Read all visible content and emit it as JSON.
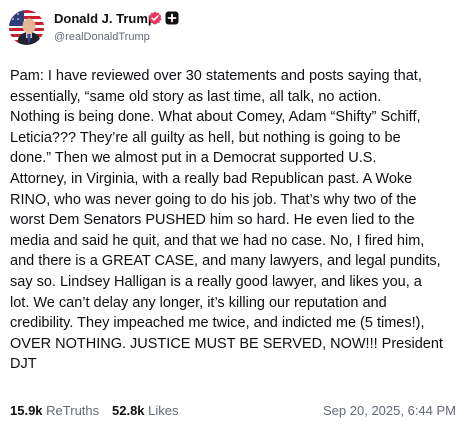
{
  "author": {
    "display_name": "Donald J. Trump",
    "handle": "@realDonaldTrump",
    "verified_icon": "verified-badge-icon",
    "extra_badge_icon": "plus-badge-icon",
    "verified_color": "#e8385d",
    "avatar_icon": "avatar-flag-portrait"
  },
  "post": {
    "lines": [
      "Pam: I have reviewed over 30 statements and posts saying that,",
      "essentially, “same old story as last time, all talk, no action.",
      "Nothing is being done. What about Comey, Adam “Shifty” Schiff,",
      "Leticia??? They’re all guilty as hell, but nothing is going to be",
      "done.” Then we almost put in a Democrat supported U.S.",
      "Attorney, in Virginia, with a really bad Republican past. A Woke",
      "RINO, who was never going to do his job. That’s why two of the",
      "worst Dem Senators PUSHED him so hard. He even lied to the",
      "media and said he quit, and that we had no case. No, I fired him,",
      "and there is a GREAT CASE, and many lawyers, and legal pundits,",
      "say so. Lindsey Halligan is a really good lawyer, and likes you, a",
      "lot. We can’t delay any longer, it’s killing our reputation and",
      "credibility. They impeached me twice, and indicted me (5 times!),",
      "OVER NOTHING. JUSTICE MUST BE SERVED, NOW!!! President",
      "DJT"
    ]
  },
  "stats": {
    "retruths_count": "15.9k",
    "retruths_label": "ReTruths",
    "likes_count": "52.8k",
    "likes_label": "Likes"
  },
  "timestamp": "Sep 20, 2025, 6:44 PM"
}
